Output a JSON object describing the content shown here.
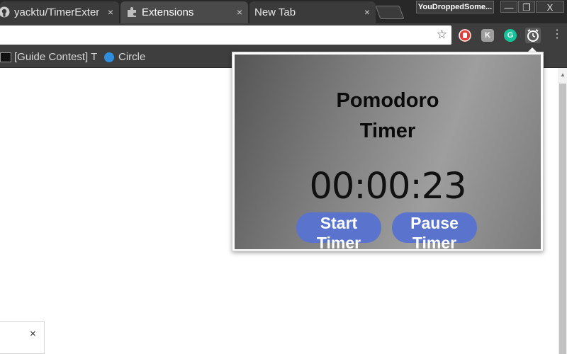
{
  "tabs": [
    {
      "label": "yacktu/TimerExten",
      "icon": "github-icon",
      "active": false
    },
    {
      "label": "Extensions",
      "icon": "puzzle-icon",
      "active": true
    },
    {
      "label": "New Tab",
      "icon": "",
      "active": false
    }
  ],
  "tab_close_glyph": "×",
  "profile_name": "YouDroppedSome...",
  "window_controls": {
    "minimize": "—",
    "restore": "❐",
    "close": "X"
  },
  "toolbar": {
    "star_glyph": "☆",
    "extensions": [
      {
        "name": "adblock-icon",
        "color": "#e53935"
      },
      {
        "name": "kami-icon",
        "color": "#9e9e9e",
        "glyph": "K"
      },
      {
        "name": "grammarly-icon",
        "color": "#15c39a",
        "glyph": "G"
      },
      {
        "name": "alarm-clock-icon",
        "color": "#cfcfcf"
      }
    ],
    "menu_glyph": "⋮"
  },
  "bookmarks": [
    {
      "label": "[Guide Contest] T",
      "icon": "site-icon"
    },
    {
      "label": "Circle",
      "icon": "water-drop-icon"
    }
  ],
  "popup": {
    "title_line1": "Pomodoro",
    "title_line2": "Timer",
    "time": "00:00:23",
    "start_label": "Start Timer",
    "pause_label": "Pause Timer"
  },
  "notice_close": "×",
  "colors": {
    "button_blue": "#5a73cd",
    "chrome_dark": "#282828",
    "toolbar": "#3e3e3e"
  }
}
